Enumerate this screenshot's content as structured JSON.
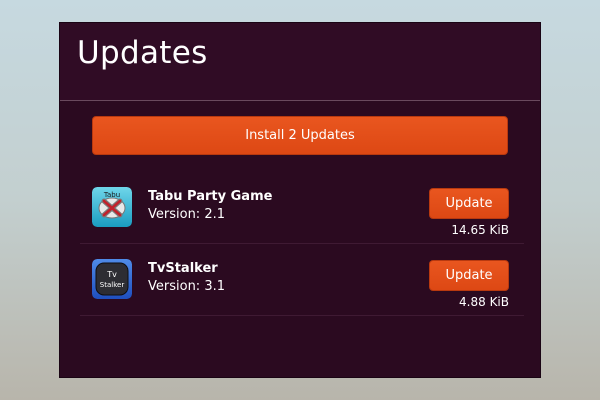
{
  "header": {
    "title": "Updates"
  },
  "install_all": {
    "label": "Install 2 Updates"
  },
  "updates": [
    {
      "name": "Tabu Party Game",
      "version": "Version: 2.1",
      "button_label": "Update",
      "size": "14.65 KiB",
      "icon": "tabu-party-game-icon",
      "icon_text": "Tabu"
    },
    {
      "name": "TvStalker",
      "version": "Version: 3.1",
      "button_label": "Update",
      "size": "4.88 KiB",
      "icon": "tvstalker-icon",
      "icon_text_top": "Tv",
      "icon_text_bottom": "Stalker"
    }
  ],
  "colors": {
    "accent": "#dd4814",
    "panel_bg": "#2b0a20"
  }
}
